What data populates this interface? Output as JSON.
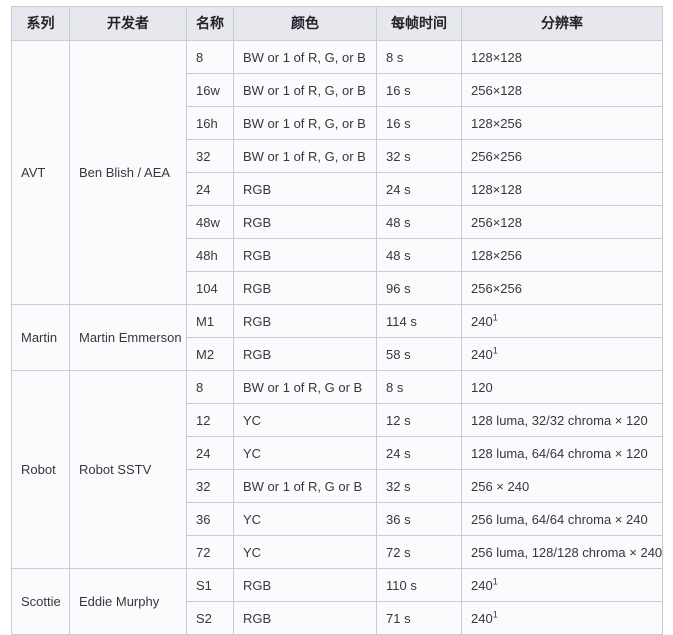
{
  "table": {
    "headers": [
      {
        "key": "series",
        "label": "系列"
      },
      {
        "key": "developer",
        "label": "开发者"
      },
      {
        "key": "name",
        "label": "名称"
      },
      {
        "key": "color",
        "label": "颜色"
      },
      {
        "key": "frame_time",
        "label": "每帧时间"
      },
      {
        "key": "resolution",
        "label": "分辨率"
      }
    ],
    "groups": [
      {
        "series": "AVT",
        "developer": "Ben Blish / AEA",
        "rows": [
          {
            "name": "8",
            "color": "BW or 1 of R, G, or B",
            "frame_time": "8 s",
            "resolution": "128×128",
            "footnote": ""
          },
          {
            "name": "16w",
            "color": "BW or 1 of R, G, or B",
            "frame_time": "16 s",
            "resolution": "256×128",
            "footnote": ""
          },
          {
            "name": "16h",
            "color": "BW or 1 of R, G, or B",
            "frame_time": "16 s",
            "resolution": "128×256",
            "footnote": ""
          },
          {
            "name": "32",
            "color": "BW or 1 of R, G, or B",
            "frame_time": "32 s",
            "resolution": "256×256",
            "footnote": ""
          },
          {
            "name": "24",
            "color": "RGB",
            "frame_time": "24 s",
            "resolution": "128×128",
            "footnote": ""
          },
          {
            "name": "48w",
            "color": "RGB",
            "frame_time": "48 s",
            "resolution": "256×128",
            "footnote": ""
          },
          {
            "name": "48h",
            "color": "RGB",
            "frame_time": "48 s",
            "resolution": "128×256",
            "footnote": ""
          },
          {
            "name": "104",
            "color": "RGB",
            "frame_time": "96 s",
            "resolution": "256×256",
            "footnote": ""
          }
        ]
      },
      {
        "series": "Martin",
        "developer": "Martin Emmerson",
        "rows": [
          {
            "name": "M1",
            "color": "RGB",
            "frame_time": "114 s",
            "resolution": "240",
            "footnote": "1"
          },
          {
            "name": "M2",
            "color": "RGB",
            "frame_time": "58 s",
            "resolution": "240",
            "footnote": "1"
          }
        ]
      },
      {
        "series": "Robot",
        "developer": "Robot SSTV",
        "rows": [
          {
            "name": "8",
            "color": "BW or 1 of R, G or B",
            "frame_time": "8 s",
            "resolution": "120",
            "footnote": ""
          },
          {
            "name": "12",
            "color": "YC",
            "frame_time": "12 s",
            "resolution": "128 luma, 32/32 chroma × 120",
            "footnote": ""
          },
          {
            "name": "24",
            "color": "YC",
            "frame_time": "24 s",
            "resolution": "128 luma, 64/64 chroma × 120",
            "footnote": ""
          },
          {
            "name": "32",
            "color": "BW or 1 of R, G or B",
            "frame_time": "32 s",
            "resolution": "256 × 240",
            "footnote": ""
          },
          {
            "name": "36",
            "color": "YC",
            "frame_time": "36 s",
            "resolution": "256 luma, 64/64 chroma × 240",
            "footnote": ""
          },
          {
            "name": "72",
            "color": "YC",
            "frame_time": "72 s",
            "resolution": "256 luma, 128/128 chroma × 240",
            "footnote": ""
          }
        ]
      },
      {
        "series": "Scottie",
        "developer": "Eddie Murphy",
        "rows": [
          {
            "name": "S1",
            "color": "RGB",
            "frame_time": "110 s",
            "resolution": "240",
            "footnote": "1"
          },
          {
            "name": "S2",
            "color": "RGB",
            "frame_time": "71 s",
            "resolution": "240",
            "footnote": "1"
          }
        ]
      }
    ]
  }
}
